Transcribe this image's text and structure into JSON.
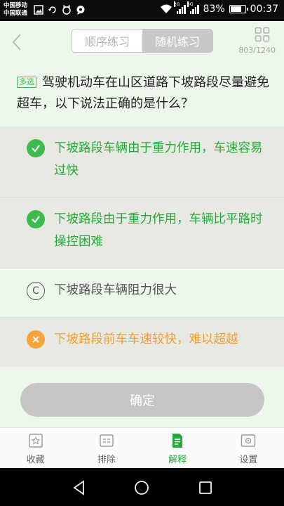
{
  "status_bar": {
    "carrier_1": "中国移动",
    "carrier_2": "中国联通",
    "net_1": "2G",
    "net_2": "3G",
    "battery": "83%",
    "battery_level": 0.83,
    "time": "00:37"
  },
  "header": {
    "tabs": [
      {
        "label": "顺序练习",
        "active": false
      },
      {
        "label": "随机练习",
        "active": true
      }
    ],
    "progress": "803/1240"
  },
  "question": {
    "tag": "多选",
    "text": "驾驶机动车在山区道路下坡路段尽量避免超车，以下说法正确的是什么？"
  },
  "options": [
    {
      "text": "下坡路段车辆由于重力作用，车速容易过快",
      "state": "correct",
      "icon": "check-icon"
    },
    {
      "text": "下坡路段由于重力作用，车辆比平路时操控困难",
      "state": "correct",
      "icon": "check-icon"
    },
    {
      "text": "下坡路段车辆阻力很大",
      "state": "unselected",
      "icon": "option-c-icon",
      "letter": "C"
    },
    {
      "text": "下坡路段前车车速较快，难以超越",
      "state": "wrong",
      "icon": "cross-icon"
    }
  ],
  "confirm_label": "确定",
  "bottom_nav": [
    {
      "label": "收藏",
      "icon": "star-icon"
    },
    {
      "label": "排除",
      "icon": "exclude-icon"
    },
    {
      "label": "解释",
      "icon": "explain-icon",
      "active": true
    },
    {
      "label": "设置",
      "icon": "settings-icon"
    }
  ],
  "colors": {
    "green": "#22aa3a",
    "orange": "#f0a030",
    "background": "#eef7ec"
  }
}
